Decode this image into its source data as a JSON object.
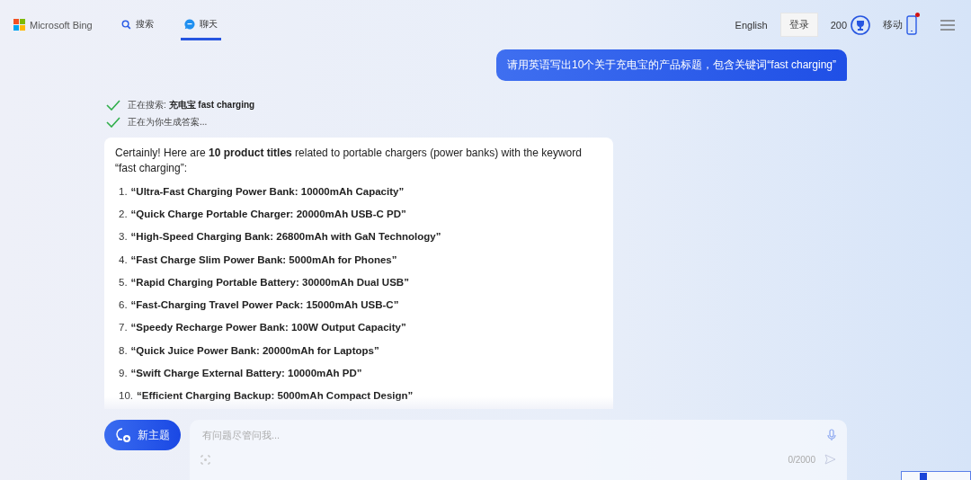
{
  "header": {
    "logo": "Microsoft Bing",
    "tabs": [
      {
        "label": "搜索",
        "kind": "search",
        "selected": false
      },
      {
        "label": "聊天",
        "kind": "chat",
        "selected": true
      }
    ],
    "language": "English",
    "login": "登录",
    "points": "200",
    "mobile": "移动",
    "mobile_notification": true
  },
  "chat": {
    "user_message": "请用英语写出10个关于充电宝的产品标题，包含关键词“fast charging”",
    "steps": [
      {
        "text": "正在搜索: **充电宝 fast charging**",
        "done": true
      },
      {
        "text": "正在为你生成答案...",
        "done": true
      }
    ],
    "answer": {
      "intro": "Certainly! Here are **10 product titles** related to portable chargers (power banks) with the keyword “fast charging”:",
      "items": [
        {
          "number": "1.",
          "title": "“Ultra-Fast Charging Power Bank: 10000mAh Capacity”"
        },
        {
          "number": "2.",
          "title": "“Quick Charge Portable Charger: 20000mAh USB-C PD”"
        },
        {
          "number": "3.",
          "title": "“High-Speed Charging Bank: 26800mAh with GaN Technology”"
        },
        {
          "number": "4.",
          "title": "“Fast Charge Slim Power Bank: 5000mAh for Phones”"
        },
        {
          "number": "5.",
          "title": "“Rapid Charging Portable Battery: 30000mAh Dual USB”"
        },
        {
          "number": "6.",
          "title": "“Fast-Charging Travel Power Pack: 15000mAh USB-C”"
        },
        {
          "number": "7.",
          "title": "“Speedy Recharge Power Bank: 100W Output Capacity”"
        },
        {
          "number": "8.",
          "title": "“Quick Juice Power Bank: 20000mAh for Laptops”"
        },
        {
          "number": "9.",
          "title": "“Swift Charge External Battery: 10000mAh PD”"
        },
        {
          "number": "10.",
          "title": "“Efficient Charging Backup: 5000mAh Compact Design”"
        }
      ]
    }
  },
  "composer": {
    "new_topic": "新主题",
    "placeholder": "有问题尽管问我...",
    "counter": "0/2000"
  }
}
